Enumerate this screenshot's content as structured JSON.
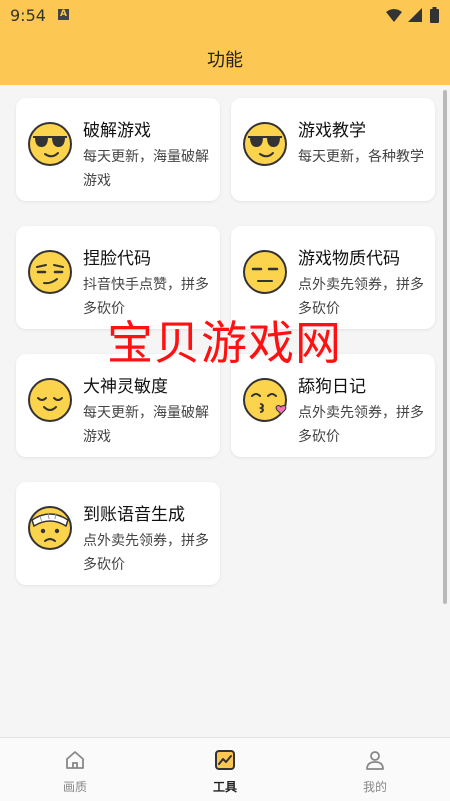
{
  "status_bar": {
    "time": "9:54",
    "sim_label": "A"
  },
  "header": {
    "title": "功能"
  },
  "cards": [
    {
      "title": "破解游戏",
      "desc": "每天更新，海量破解游戏",
      "icon": "sunglasses-face-icon"
    },
    {
      "title": "游戏教学",
      "desc": "每天更新，各种教学",
      "icon": "sunglasses-face-icon"
    },
    {
      "title": "捏脸代码",
      "desc": "抖音快手点赞，拼多多砍价",
      "icon": "smirk-face-icon"
    },
    {
      "title": "游戏物质代码",
      "desc": "点外卖先领券，拼多多砍价",
      "icon": "neutral-face-icon"
    },
    {
      "title": "大神灵敏度",
      "desc": "每天更新，海量破解游戏",
      "icon": "relieved-face-icon"
    },
    {
      "title": "舔狗日记",
      "desc": "点外卖先领券，拼多多砍价",
      "icon": "kissing-face-icon"
    },
    {
      "title": "到账语音生成",
      "desc": "点外卖先领券，拼多多砍价",
      "icon": "bandaged-face-icon"
    }
  ],
  "watermark": "宝贝游戏网",
  "bottom_nav": [
    {
      "label": "画质",
      "icon": "home-icon",
      "active": false
    },
    {
      "label": "工具",
      "icon": "tools-icon",
      "active": true
    },
    {
      "label": "我的",
      "icon": "profile-icon",
      "active": false
    }
  ],
  "colors": {
    "accent": "#fcc853",
    "face": "#fcd34d",
    "watermark": "#ff1111"
  }
}
